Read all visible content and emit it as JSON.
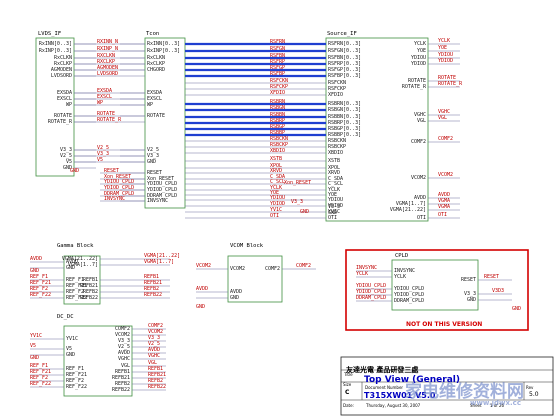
{
  "colors": {
    "block_border": "#3f8f3f",
    "wire": "#7070a0",
    "bus": "#1f3fd0",
    "net": "#c00000",
    "highlight": "#d40000",
    "title": "#0000c0"
  },
  "blocks": {
    "lvds_if": {
      "title": "LVDS_IF",
      "pins_left": [],
      "pins_right": [
        "RxINN[0..3]",
        "RxINP[0..3]",
        "RxCLKN",
        "RxCLKP",
        "AGMODEN",
        "LVDSORD",
        "EXSDA",
        "EXSCL",
        "WP",
        "ROTATE",
        "ROTATE_R",
        "V3_3",
        "V2_5",
        "V5",
        "GND"
      ]
    },
    "tcon": {
      "title": "Tcon",
      "pins_left": [
        "RxINN[0..3]",
        "RxINP[0..3]",
        "RxCLKN",
        "RxCLKP",
        "CHGORD",
        "EXSDA",
        "EXSCL",
        "WP",
        "ROTATE",
        "V2_5",
        "V3_3",
        "GND",
        "RESET",
        "Xon_RESET",
        "YDIOU_CPLD",
        "YDIOD_CPLD",
        "DDRAM_CPLD",
        "INVSYNC"
      ],
      "pins_right": []
    },
    "source_if": {
      "title": "Source_IF",
      "pins_left": [
        "RSFRN[0..3]",
        "RSFGN[0..3]",
        "RSFBN[0..3]",
        "RSFRP[0..3]",
        "RSFGP[0..3]",
        "RSFBP[0..3]",
        "RSFCKN",
        "RSFCKP",
        "XFDIO",
        "RSBRN[0..3]",
        "RSBGN[0..3]",
        "RSBBN[0..3]",
        "RSBRP[0..3]",
        "RSBGP[0..3]",
        "RSBBP[0..3]",
        "RSBCKN",
        "RSBCKP",
        "XBDIO",
        "XSTB",
        "XPOL",
        "XRVD",
        "C_SDA",
        "C_SCL",
        "YCLK",
        "YOE",
        "YDIOU",
        "YDIOD",
        "YV1C",
        "OTI"
      ],
      "pins_right": [
        "YCLK",
        "YOE",
        "YDIOU",
        "YDIOD",
        "ROTATE",
        "ROTATE_R",
        "VGHC",
        "VGL",
        "COMF2",
        "VCOM2",
        "AVDD",
        "VGMA[1..7]",
        "VGMA[21..22]",
        "OTI"
      ],
      "pins_left_bottom": [
        "V3_3",
        "GND"
      ]
    },
    "gamma": {
      "title": "Gamma Block",
      "pins_left": [
        "AVDD",
        "GND",
        "REF_F1",
        "REF_F21",
        "REF_F2",
        "REF_F22"
      ],
      "pins_right": [
        "VGMA[21..22]",
        "VGMA[1..7]",
        "REFB1",
        "REFB21",
        "REFB2",
        "REFB22"
      ]
    },
    "vcom": {
      "title": "VCOM Block",
      "pins_left": [
        "VCOM2",
        "AVDD",
        "GND"
      ],
      "pins_right": [
        "COMF2"
      ]
    },
    "dc_dc": {
      "title": "DC_DC",
      "pins_left": [
        "YV1C",
        "V5",
        "GND",
        "REF_F1",
        "REF_F21",
        "REF_F2",
        "REF_F22"
      ],
      "pins_right": [
        "COMF2",
        "VCOM2",
        "V3_3",
        "V2_5",
        "AVDD",
        "VGHC",
        "VGL",
        "REFB1",
        "REFB21",
        "REFB2",
        "REFB22"
      ]
    },
    "cpld": {
      "title": "CPLD",
      "pins_left": [
        "INVSYNC",
        "YCLK",
        "YDIOU_CPLD",
        "YDIOD_CPLD",
        "DDRAM_CPLD"
      ],
      "pins_right": [
        "RESET",
        "V3_3",
        "GND"
      ]
    }
  },
  "nets": {
    "lvds_tcon": [
      "RXINN_N",
      "RXINP_N",
      "RXCLKN",
      "RXCLKP",
      "AGMODEN",
      "LVDSORD",
      "EXSDA",
      "EXSCL",
      "WP",
      "ROTATE",
      "ROTATE_R",
      "V2_5",
      "V3_3",
      "V5"
    ],
    "tcon_right": [
      "RSFRN",
      "RSFGN",
      "RSFBN",
      "RSFRP",
      "RSFGP",
      "RSFBP",
      "RSFCKN",
      "RSFCKP",
      "XFDIO",
      "RSBRN",
      "RSBGN",
      "RSBBN",
      "RSBRP",
      "RSBGP",
      "RSBBP",
      "RSBCKN",
      "RSBCKP",
      "XBDIO",
      "XSTB",
      "XPOL",
      "XRVD",
      "C_SDA",
      "C_SCL",
      "YCLK",
      "YOE",
      "YDIOU",
      "YDIOD",
      "YV1C",
      "OTI"
    ],
    "tcon_left": [
      "RESET",
      "Xon_RESET",
      "YDIOU_CPLD",
      "YDIOD_CPLD",
      "DDRAM_CPLD",
      "INVSYNC"
    ],
    "source_right": [
      "YCLK",
      "YOE",
      "YDIOU",
      "YDIOD",
      "ROTATE",
      "ROTATE_R",
      "VGHC",
      "VGL",
      "COMF2",
      "VCOM2",
      "AVDD",
      "VGMA",
      "VGMA",
      "OTI"
    ],
    "source_left_bottom": [
      "Xon_RESET",
      "V3_3"
    ],
    "gamma_left": [
      "AVDD",
      "REF_F1",
      "REF_F21",
      "REF_F2",
      "REF_F22"
    ],
    "gamma_right": [
      "VGMA[21..22]",
      "VGMA[1..7]",
      "REFB1",
      "REFB21",
      "REFB2",
      "REFB22"
    ],
    "vcom": [
      "VCOM2",
      "AVDD",
      "COMF2"
    ],
    "dcdc_left": [
      "YV1C",
      "V5",
      "REF_F1",
      "REF_F21",
      "REF_F2",
      "REF_F22"
    ],
    "dcdc_right": [
      "COMF2",
      "VCOM2",
      "V3_3",
      "V2_5",
      "AVDD",
      "VGHC",
      "VGL",
      "REFB1",
      "REFB21",
      "REFB2",
      "REFB22"
    ],
    "cpld_left": [
      "INVSYNC",
      "YCLK",
      "YDIOU_CPLD",
      "YDIOD_CPLD",
      "DDRAM_CPLD"
    ],
    "cpld_right": [
      "RESET",
      "V3D3"
    ],
    "gnd": "GND"
  },
  "cpld_note": "NOT ON THIS VERSION",
  "title_block": {
    "company": "友達光電 產品研發三處",
    "title_label": "Title",
    "title": "Top View (General)",
    "doc_label": "Document Number",
    "doc_number": "T315XW01 V5.0",
    "size_label": "Size",
    "size": "C",
    "rev_label": "Rev",
    "rev": "5.0",
    "date_label": "Date:",
    "date": "Thursday, August 30, 2007",
    "sheet_label": "Sheet",
    "sheet": "1 of 26"
  },
  "watermark": {
    "text": "家电维修资料网",
    "url": "www.jdwx.cc"
  }
}
